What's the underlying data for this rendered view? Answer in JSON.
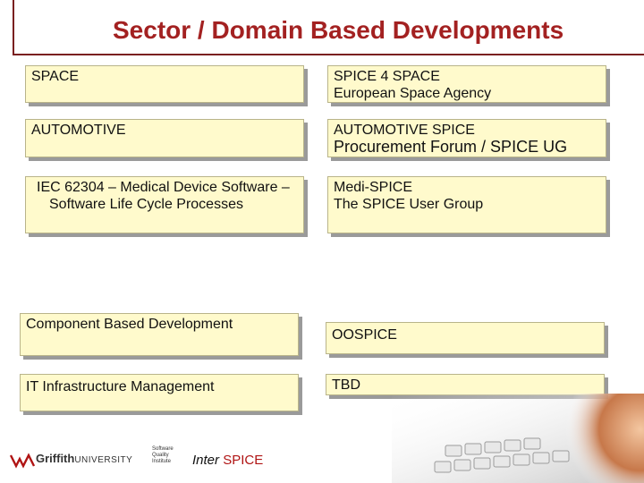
{
  "title": "Sector / Domain Based Developments",
  "rows": [
    {
      "left": [
        "SPACE"
      ],
      "right": [
        "SPICE 4 SPACE",
        "European Space Agency"
      ]
    },
    {
      "left": [
        "AUTOMOTIVE"
      ],
      "right": [
        "AUTOMOTIVE SPICE",
        "Procurement Forum / SPICE UG"
      ]
    },
    {
      "left": [
        "IEC 62304 – Medical Device Software – Software Life Cycle Processes"
      ],
      "right": [
        "Medi-SPICE",
        "The SPICE User Group"
      ]
    },
    {
      "left": [
        "Component Based Development"
      ],
      "right": [
        "OOSPICE"
      ]
    },
    {
      "left": [
        "IT Infrastructure Management"
      ],
      "right": [
        "TBD"
      ]
    }
  ],
  "footer": {
    "griffith": "Griffith",
    "university": "UNIVERSITY",
    "sqi": [
      "Software",
      "Quality",
      "Institute"
    ],
    "inter": "Inter",
    "spice": "SPICE"
  },
  "colors": {
    "title": "#a32121",
    "box_fill": "#fffacc",
    "box_shadow": "#9a9a9a",
    "accent_red": "#b01414"
  }
}
